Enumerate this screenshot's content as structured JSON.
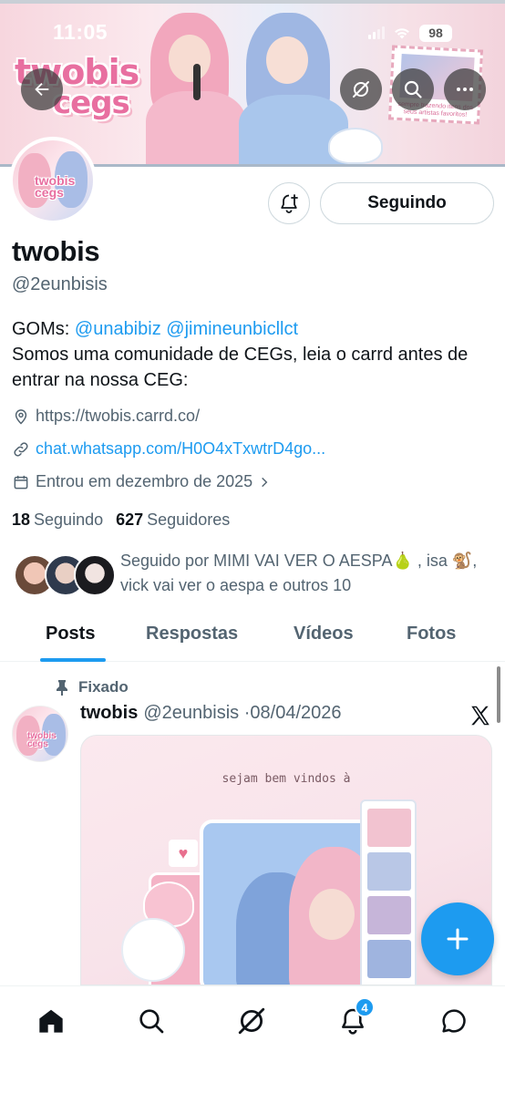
{
  "status_bar": {
    "time": "11:05",
    "battery": "98"
  },
  "banner": {
    "logo_line1": "twobis",
    "logo_line2": "cegs",
    "stamp_text": "sempre trazendo itens dos seus artistas favoritos!",
    "overlay_icons": [
      "back-arrow-icon",
      "grok-icon",
      "search-icon",
      "more-icon"
    ]
  },
  "avatar": {
    "logo_line1": "twobis",
    "logo_line2": "cegs"
  },
  "profile": {
    "follow_button": "Seguindo",
    "display_name": "twobis",
    "handle": "@2eunbisis",
    "bio": {
      "prefix": "GOMs: ",
      "mention1": "@unabibiz",
      "mention2": "@jimineunbicllct",
      "line2": " Somos uma comunidade de CEGs, leia o carrd antes de entrar na nossa CEG:"
    },
    "location": "https://twobis.carrd.co/",
    "website": "chat.whatsapp.com/H0O4xTxwtrD4go...",
    "joined": "Entrou em dezembro de 2025",
    "following_count": "18",
    "following_label": "Seguindo",
    "followers_count": "627",
    "followers_label": "Seguidores",
    "followed_by": "Seguido por MIMI VAI VER O AESPA🍐 , isa 🐒, vick vai ver o aespa e outros 10"
  },
  "tabs": [
    {
      "label": "Posts",
      "active": true
    },
    {
      "label": "Respostas",
      "active": false
    },
    {
      "label": "Vídeos",
      "active": false
    },
    {
      "label": "Fotos",
      "active": false
    }
  ],
  "pinned_post": {
    "pinned_label": "Fixado",
    "author_name": "twobis",
    "author_handle": "@2eunbisis",
    "date": "08/04/2026",
    "separator": "·",
    "media_caption": "sejam bem vindos à"
  },
  "bottom_nav": {
    "items": [
      "home-icon",
      "search-icon",
      "grok-icon",
      "notifications-icon",
      "messages-icon"
    ],
    "notifications_badge": "4"
  },
  "colors": {
    "accent": "#1d9bf0",
    "text_primary": "#0f1419",
    "text_secondary": "#536471",
    "border": "#cfd9de"
  }
}
